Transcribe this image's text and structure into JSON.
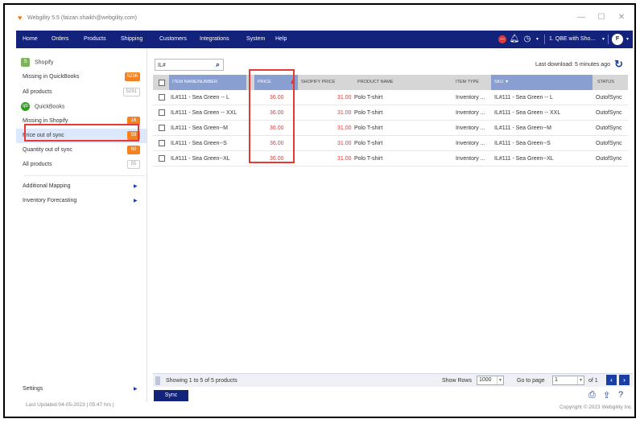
{
  "window": {
    "title": "Webgility 5.5 (faizan.shaikh@webgility.com)",
    "min": "—",
    "max": "☐",
    "close": "✕"
  },
  "nav": {
    "items": [
      "Home",
      "Orders",
      "Products",
      "Shipping",
      "Customers",
      "Integrations",
      "System",
      "Help"
    ],
    "company": "1. QBE with Sho...",
    "avatar": "F"
  },
  "sidebar": {
    "shopify_header": "Shopify",
    "quickbooks_header": "QuickBooks",
    "items": [
      {
        "label": "Missing in QuickBooks",
        "badge": "5236"
      },
      {
        "label": "All products",
        "badge": "5291"
      },
      {
        "label": "Missing in Shopify",
        "badge": "16"
      },
      {
        "label": "Price out of sync",
        "badge": "59"
      },
      {
        "label": "Quantity out of sync",
        "badge": "60"
      },
      {
        "label": "All products",
        "badge": "55"
      }
    ],
    "links": [
      "Additional Mapping",
      "Inventory Forecasting"
    ],
    "settings": "Settings",
    "last_updated": "Last Updated:04-05-2023 | 05:47 hrs |"
  },
  "main": {
    "search_value": "IL#",
    "last_download": "Last download: 5 minutes ago",
    "columns": [
      "ITEM NAME/NUMBER",
      "PRICE",
      "SHOPIFY PRICE",
      "PRODUCT NAME",
      "ITEM TYPE",
      "SKU ▼",
      "STATUS"
    ],
    "rows": [
      {
        "name": "IL#111 - Sea Green -- L",
        "price": "36.00",
        "shopify_price": "31.00",
        "product": "Polo T-shirt",
        "type": "Inventory ...",
        "sku": "IL#111 - Sea Green -- L",
        "status": "OutofSync"
      },
      {
        "name": "IL#111 - Sea Green -- XXL",
        "price": "36.00",
        "shopify_price": "31.00",
        "product": "Polo T-shirt",
        "type": "Inventory ...",
        "sku": "IL#111 - Sea Green -- XXL",
        "status": "OutofSync"
      },
      {
        "name": "IL#111 - Sea Green--M",
        "price": "36.00",
        "shopify_price": "31.00",
        "product": "Polo T-shirt",
        "type": "Inventory ...",
        "sku": "IL#111 - Sea Green--M",
        "status": "OutofSync"
      },
      {
        "name": "IL#111 - Sea Green--S",
        "price": "36.00",
        "shopify_price": "31.00",
        "product": "Polo T-shirt",
        "type": "Inventory ...",
        "sku": "IL#111 - Sea Green--S",
        "status": "OutofSync"
      },
      {
        "name": "IL#111 - Sea Green--XL",
        "price": "36.00",
        "shopify_price": "31.00",
        "product": "Polo T-shirt",
        "type": "Inventory ...",
        "sku": "IL#111 - Sea Green--XL",
        "status": "OutofSync"
      }
    ],
    "pager": {
      "showing": "Showing 1 to 5 of 5 products",
      "show_rows_label": "Show Rows",
      "show_rows_value": "1000",
      "go_to_page_label": "Go to page",
      "page_value": "1",
      "of_pages": "of 1"
    },
    "sync_label": "Sync",
    "copyright": "Copyright © 2023 Webgility Inc."
  },
  "colors": {
    "navbar": "#13227a",
    "accent": "#1a3ea8",
    "badge": "#f5821f",
    "highlight": "#e53935"
  },
  "icons": [
    "webgility-logo-icon",
    "stop-icon",
    "bell-icon",
    "clock-icon",
    "search-icon",
    "refresh-icon",
    "warning-icon",
    "print-icon",
    "export-icon",
    "help-icon",
    "shopify-icon",
    "quickbooks-icon"
  ]
}
